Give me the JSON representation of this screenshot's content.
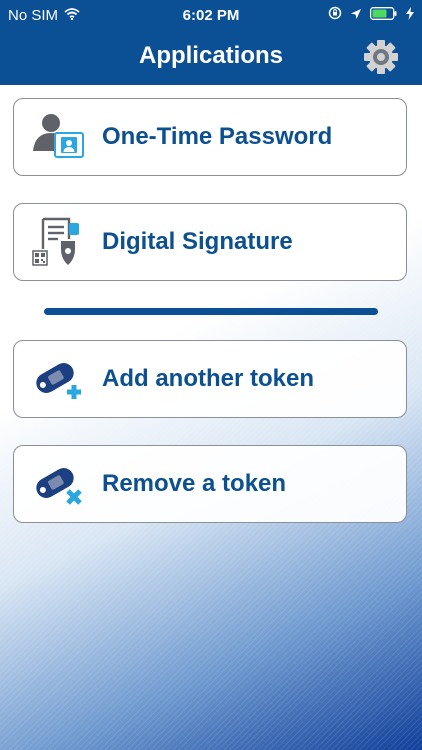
{
  "status": {
    "carrier": "No SIM",
    "time": "6:02 PM"
  },
  "header": {
    "title": "Applications"
  },
  "menu": [
    {
      "label": "One-Time Password",
      "icon": "otp-user-icon"
    },
    {
      "label": "Digital Signature",
      "icon": "digital-signature-icon"
    },
    {
      "label": "Add another token",
      "icon": "add-token-icon"
    },
    {
      "label": "Remove a token",
      "icon": "remove-token-icon"
    }
  ],
  "colors": {
    "brand": "#0b4f95",
    "label": "#0c5091",
    "accent": "#2aa7e0"
  }
}
